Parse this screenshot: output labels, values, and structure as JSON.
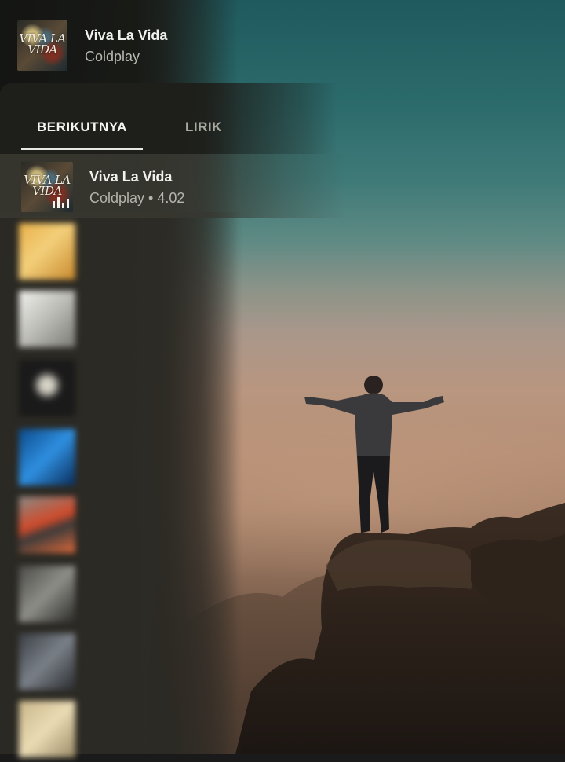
{
  "now_playing": {
    "title": "Viva La Vida",
    "artist": "Coldplay"
  },
  "tabs": [
    {
      "label": "BERIKUTNYA",
      "active": true
    },
    {
      "label": "LIRIK",
      "active": false
    }
  ],
  "queue": {
    "current": {
      "title": "Viva La Vida",
      "subtitle": "Coldplay • 4.02"
    }
  },
  "album_art_text": "VIVA LA VIDA",
  "colors": {
    "panel": "#1e1e1a",
    "accent_text": "#f0f0ec",
    "muted_text": "#b8b8b0",
    "sky_top": "#1f5a5e",
    "sky_horizon": "#b9967f"
  }
}
